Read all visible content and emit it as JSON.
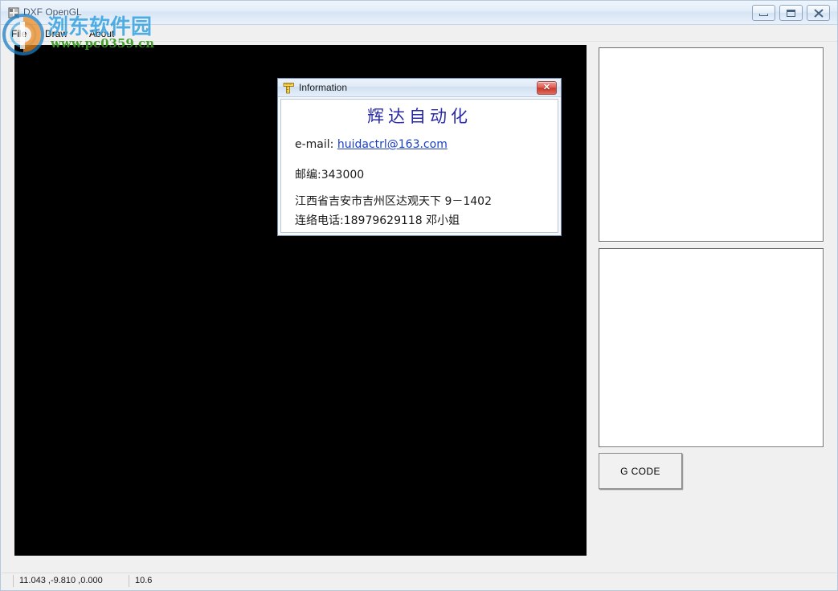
{
  "window": {
    "title": "DXF OpenGL",
    "app_icon_name": "dxf-app-icon",
    "controls": {
      "minimize_label": "Minimize",
      "maximize_label": "Maximize",
      "close_label": "Close"
    }
  },
  "menubar": {
    "items": [
      {
        "label": "File"
      },
      {
        "label": "Draw"
      },
      {
        "label": "About"
      }
    ]
  },
  "main": {
    "canvas_name": "opengl-viewport",
    "listbox_top_value": "",
    "listbox_bottom_value": "",
    "gcode_button_label": "G CODE"
  },
  "statusbar": {
    "coordinates": "11.043 ,-9.810 ,0.000",
    "zoom_value": "10.6"
  },
  "dialog": {
    "title": "Information",
    "icon_name": "ruler-icon",
    "close_glyph": "✕",
    "heading": "辉达自动化",
    "email_label": "e-mail: ",
    "email_address": "huidactrl@163.com",
    "zip_line": "邮编:343000",
    "address_line": "江西省吉安市吉州区达观天下 9－1402",
    "phone_line": "连络电话:18979629118 邓小姐"
  },
  "watermark": {
    "site_name": "洌东软件园",
    "url": "www.pc0359.cn"
  },
  "colors": {
    "heading_blue": "#2a2aa8",
    "link_blue": "#1b3fc4",
    "watermark_blue": "#2e9fe0",
    "watermark_green": "#3a9a22",
    "close_red": "#c8392c",
    "canvas_black": "#000000"
  }
}
